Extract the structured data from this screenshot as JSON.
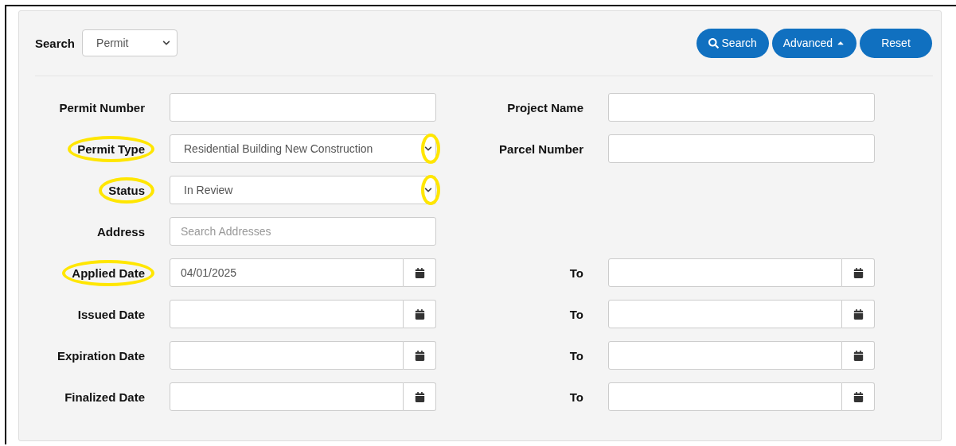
{
  "search_bar": {
    "label": "Search",
    "select_value": "Permit"
  },
  "buttons": [
    {
      "kind": "search",
      "label": "Search"
    },
    {
      "kind": "advanced",
      "label": "Advanced"
    },
    {
      "kind": "reset",
      "label": "Reset"
    }
  ],
  "rows": [
    {
      "left": {
        "label": "Permit Number",
        "kind": "text",
        "highlighted": false
      },
      "right": {
        "label": "Project Name",
        "kind": "text"
      }
    },
    {
      "left": {
        "label": "Permit Type",
        "kind": "select",
        "value": "Residential Building New Construction",
        "highlighted": true,
        "caret_highlighted": true
      },
      "right": {
        "label": "Parcel Number",
        "kind": "text"
      }
    },
    {
      "left": {
        "label": "Status",
        "kind": "select",
        "value": "In Review",
        "highlighted": true,
        "caret_highlighted": true
      }
    },
    {
      "left": {
        "label": "Address",
        "kind": "text",
        "placeholder": "Search Addresses",
        "highlighted": false
      }
    },
    {
      "left": {
        "label": "Applied Date",
        "kind": "date",
        "value": "04/01/2025",
        "highlighted": true
      },
      "right": {
        "label": "To",
        "kind": "date"
      }
    },
    {
      "left": {
        "label": "Issued Date",
        "kind": "date",
        "highlighted": false
      },
      "right": {
        "label": "To",
        "kind": "date"
      }
    },
    {
      "left": {
        "label": "Expiration Date",
        "kind": "date",
        "highlighted": false
      },
      "right": {
        "label": "To",
        "kind": "date"
      }
    },
    {
      "left": {
        "label": "Finalized Date",
        "kind": "date",
        "highlighted": false
      },
      "right": {
        "label": "To",
        "kind": "date"
      }
    }
  ]
}
